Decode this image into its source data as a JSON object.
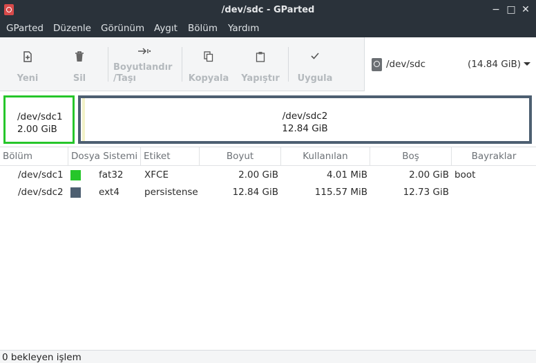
{
  "window": {
    "title": "/dev/sdc - GParted"
  },
  "menu": [
    "GParted",
    "Düzenle",
    "Görünüm",
    "Aygıt",
    "Bölüm",
    "Yardım"
  ],
  "toolbar": {
    "new": "Yeni",
    "delete": "Sil",
    "resize_line1": "Boyutlandır",
    "resize_line2": "/Taşı",
    "copy": "Kopyala",
    "paste": "Yapıştır",
    "apply": "Uygula"
  },
  "device": {
    "name": "/dev/sdc",
    "size": "(14.84 GiB)"
  },
  "map": [
    {
      "name": "/dev/sdc1",
      "size": "2.00 GiB",
      "color": "#26c62a"
    },
    {
      "name": "/dev/sdc2",
      "size": "12.84 GiB",
      "color": "#4d5f71"
    }
  ],
  "columns": [
    "Bölüm",
    "Dosya Sistemi",
    "Etiket",
    "Boyut",
    "Kullanılan",
    "Boş",
    "Bayraklar"
  ],
  "rows": [
    {
      "partition": "/dev/sdc1",
      "filesystem": "fat32",
      "fs_color": "#26c62a",
      "label": "XFCE",
      "size": "2.00 GiB",
      "used": "4.01 MiB",
      "free": "2.00 GiB",
      "flags": "boot"
    },
    {
      "partition": "/dev/sdc2",
      "filesystem": "ext4",
      "fs_color": "#4d5f71",
      "label": "persistense",
      "size": "12.84 GiB",
      "used": "115.57 MiB",
      "free": "12.73 GiB",
      "flags": ""
    }
  ],
  "status": "0 bekleyen işlem"
}
